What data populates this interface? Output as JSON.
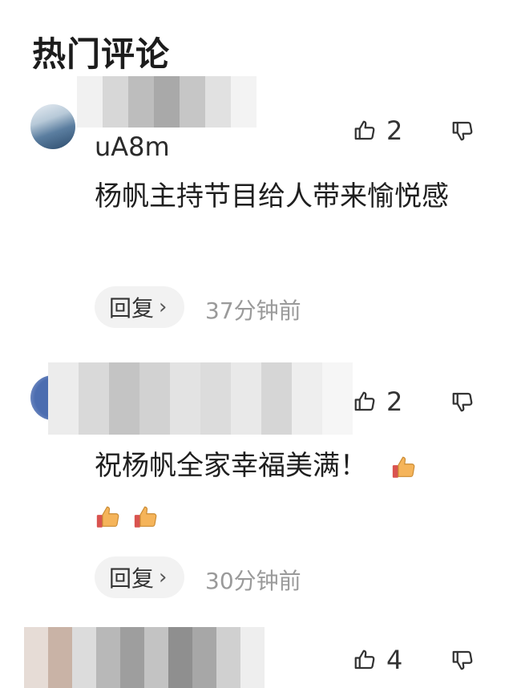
{
  "section": {
    "title": "热门评论"
  },
  "comments": [
    {
      "username_visible": "uA8m",
      "text": "杨帆主持节目给人带来愉悦感",
      "likes": "2",
      "reply_label": "回复",
      "reply_chevron": "›",
      "time": "37分钟前"
    },
    {
      "username_visible": "",
      "text": "祝杨帆全家幸福美满！",
      "likes": "2",
      "reply_label": "回复",
      "reply_chevron": "›",
      "time": "30分钟前"
    },
    {
      "username_visible": "",
      "text": "",
      "likes": "4",
      "reply_label": "",
      "time": ""
    }
  ],
  "icons": {
    "like": "thumbs-up-outline-icon",
    "dislike": "thumbs-down-outline-icon",
    "emoji": "thumbs-up-emoji-icon"
  },
  "colors": {
    "text": "#1f1f1f",
    "muted": "#9a9a9a",
    "reply_bg": "#f2f2f2"
  }
}
